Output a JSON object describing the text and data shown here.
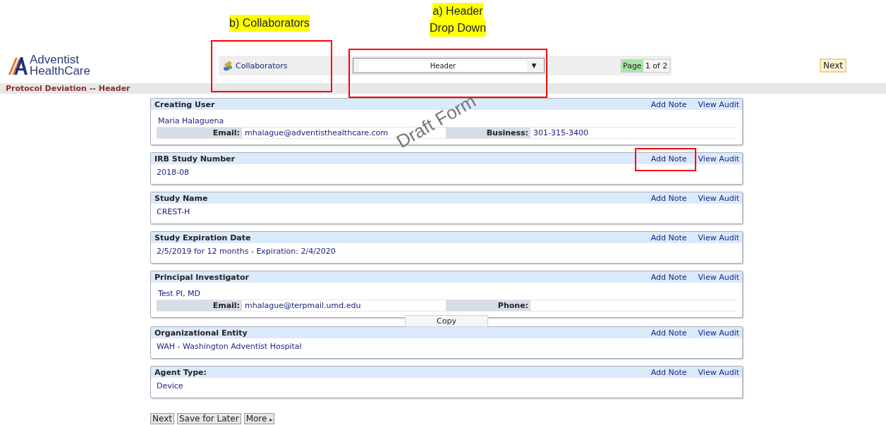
{
  "annotations": {
    "collaborators_label": [
      "b) Collaborators"
    ],
    "dropdown_label": [
      "a) Header",
      "Drop Down"
    ]
  },
  "logo": {
    "line_1": "Adventist",
    "line_2": "HealthCare"
  },
  "toolbar": {
    "collaborators": "Collaborators",
    "dropdown": {
      "value": "Header",
      "arrow": "▼"
    },
    "page": {
      "label": "Page",
      "count": "1 of 2"
    },
    "next": "Next"
  },
  "page_title": "Protocol Deviation -- Header",
  "watermark": "Draft Form",
  "sections": [
    {
      "kind": "person",
      "title": "Creating User",
      "actions": [
        "Add Note",
        "View Audit"
      ],
      "name": "Maria Halaguena",
      "fields": [
        {
          "label": "Email:",
          "value": "mhalague@adventisthealthcare.com"
        },
        {
          "label": "Business:",
          "value": "301-315-3400"
        }
      ]
    },
    {
      "kind": "value",
      "title": "IRB Study Number",
      "actions": [
        "Add Note",
        "View Audit"
      ],
      "value": "2018-08"
    },
    {
      "kind": "value",
      "title": "Study Name",
      "actions": [
        "Add Note",
        "View Audit"
      ],
      "value": "CREST-H"
    },
    {
      "kind": "value",
      "title": "Study Expiration Date",
      "actions": [
        "Add Note",
        "View Audit"
      ],
      "value": "2/5/2019 for 12 months - Expiration: 2/4/2020"
    },
    {
      "kind": "person",
      "title": "Principal Investigator",
      "actions": [
        "Add Note",
        "View Audit"
      ],
      "name": "Test PI, MD",
      "fields": [
        {
          "label": "Email:",
          "value": "mhalague@terpmail.umd.edu"
        },
        {
          "label": "Phone:"
        }
      ],
      "copy": "Copy"
    },
    {
      "kind": "value",
      "title": "Organizational Entity",
      "actions": [
        "Add Note",
        "View Audit"
      ],
      "value": "WAH - Washington Adventist Hospital"
    },
    {
      "kind": "value",
      "title": "Agent Type:",
      "actions": [
        "Add Note",
        "View Audit"
      ],
      "value": "Device"
    }
  ],
  "buttons": [
    {
      "label": "Next"
    },
    {
      "label": "Save for Later"
    },
    {
      "label": "More",
      "arrow": "▸"
    }
  ]
}
